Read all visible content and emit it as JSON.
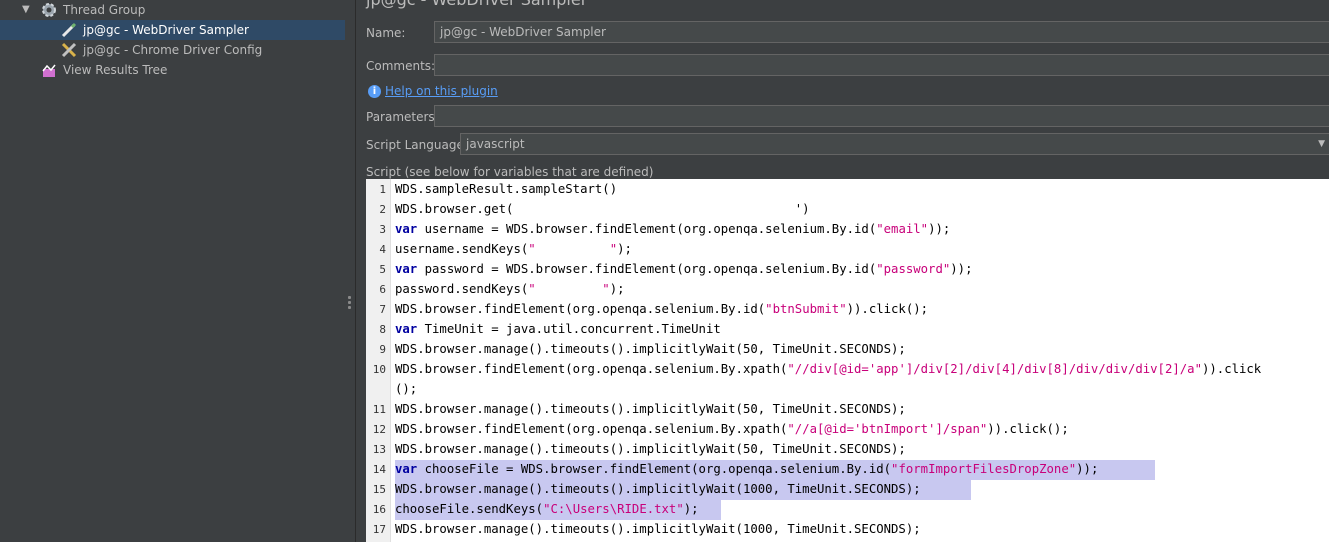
{
  "tree": {
    "items": [
      {
        "label": "Thread Group",
        "icon": "gear-icon"
      },
      {
        "label": "jp@gc - WebDriver Sampler",
        "icon": "pen-icon",
        "selected": true
      },
      {
        "label": "jp@gc - Chrome Driver Config",
        "icon": "wrench-icon"
      },
      {
        "label": "View Results Tree",
        "icon": "chart-icon"
      }
    ]
  },
  "panel": {
    "title": "jp@gc - WebDriver Sampler",
    "name_label": "Name:",
    "name_value": "jp@gc - WebDriver Sampler",
    "comments_label": "Comments:",
    "comments_value": "",
    "help_link": "Help on this plugin",
    "parameters_label": "Parameters:",
    "parameters_value": "",
    "language_label": "Script Language:",
    "language_value": "javascript",
    "script_label": "Script (see below for variables that are defined)"
  },
  "script": {
    "line_numbers": [
      "1",
      "2",
      "3",
      "4",
      "5",
      "6",
      "7",
      "8",
      "9",
      "10",
      "11",
      "12",
      "13",
      "14",
      "15",
      "16",
      "17"
    ],
    "lines": [
      "WDS.sampleResult.sampleStart()",
      "WDS.browser.get(                                      ')",
      "var username = WDS.browser.findElement(org.openqa.selenium.By.id(\"email\"));",
      "username.sendKeys(\"          \");",
      "var password = WDS.browser.findElement(org.openqa.selenium.By.id(\"password\"));",
      "password.sendKeys(\"         \");",
      "WDS.browser.findElement(org.openqa.selenium.By.id(\"btnSubmit\")).click();",
      "var TimeUnit = java.util.concurrent.TimeUnit",
      "WDS.browser.manage().timeouts().implicitlyWait(50, TimeUnit.SECONDS);",
      "WDS.browser.findElement(org.openqa.selenium.By.xpath(\"//div[@id='app']/div[2]/div[4]/div[8]/div/div/div[2]/a\")).click",
      "();",
      "WDS.browser.manage().timeouts().implicitlyWait(50, TimeUnit.SECONDS);",
      "WDS.browser.findElement(org.openqa.selenium.By.xpath(\"//a[@id='btnImport']/span\")).click();",
      "WDS.browser.manage().timeouts().implicitlyWait(50, TimeUnit.SECONDS);",
      "var chooseFile = WDS.browser.findElement(org.openqa.selenium.By.id(\"formImportFilesDropZone\"));",
      "WDS.browser.manage().timeouts().implicitlyWait(1000, TimeUnit.SECONDS);",
      "chooseFile.sendKeys(\"C:\\Users\\RIDE.txt\");",
      "WDS.browser.manage().timeouts().implicitlyWait(1000, TimeUnit.SECONDS);"
    ]
  },
  "colors": {
    "selection": "#2f4a66",
    "highlight": "#c8c8f0",
    "keyword": "#0000a0",
    "string": "#c8007a",
    "link": "#589df6"
  }
}
